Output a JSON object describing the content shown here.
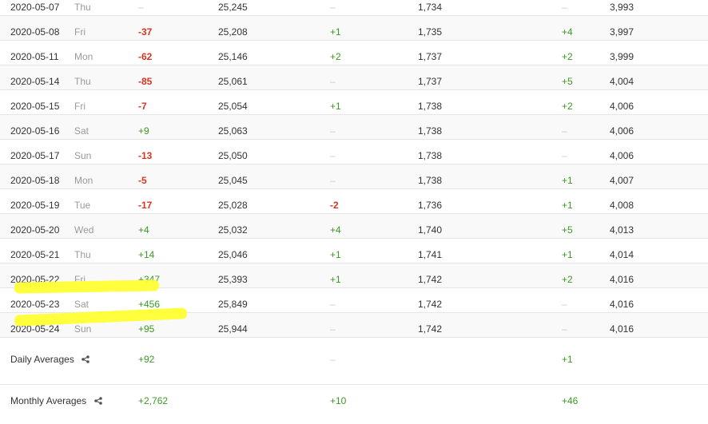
{
  "colors": {
    "negative": "#d9341f",
    "positive": "#3a9a22",
    "dash": "#c8c8c8",
    "highlight": "#ffff33"
  },
  "rows": [
    {
      "date": "2020-05-07",
      "day": "Thu",
      "d1": "–",
      "subs": "25,245",
      "d2": "–",
      "uploads": "1,734",
      "d3": "–",
      "views": "3,993"
    },
    {
      "date": "2020-05-08",
      "day": "Fri",
      "d1": "-37",
      "subs": "25,208",
      "d2": "+1",
      "uploads": "1,735",
      "d3": "+4",
      "views": "3,997"
    },
    {
      "date": "2020-05-11",
      "day": "Mon",
      "d1": "-62",
      "subs": "25,146",
      "d2": "+2",
      "uploads": "1,737",
      "d3": "+2",
      "views": "3,999"
    },
    {
      "date": "2020-05-14",
      "day": "Thu",
      "d1": "-85",
      "subs": "25,061",
      "d2": "–",
      "uploads": "1,737",
      "d3": "+5",
      "views": "4,004"
    },
    {
      "date": "2020-05-15",
      "day": "Fri",
      "d1": "-7",
      "subs": "25,054",
      "d2": "+1",
      "uploads": "1,738",
      "d3": "+2",
      "views": "4,006"
    },
    {
      "date": "2020-05-16",
      "day": "Sat",
      "d1": "+9",
      "subs": "25,063",
      "d2": "–",
      "uploads": "1,738",
      "d3": "–",
      "views": "4,006"
    },
    {
      "date": "2020-05-17",
      "day": "Sun",
      "d1": "-13",
      "subs": "25,050",
      "d2": "–",
      "uploads": "1,738",
      "d3": "–",
      "views": "4,006"
    },
    {
      "date": "2020-05-18",
      "day": "Mon",
      "d1": "-5",
      "subs": "25,045",
      "d2": "–",
      "uploads": "1,738",
      "d3": "+1",
      "views": "4,007"
    },
    {
      "date": "2020-05-19",
      "day": "Tue",
      "d1": "-17",
      "subs": "25,028",
      "d2": "-2",
      "uploads": "1,736",
      "d3": "+1",
      "views": "4,008"
    },
    {
      "date": "2020-05-20",
      "day": "Wed",
      "d1": "+4",
      "subs": "25,032",
      "d2": "+4",
      "uploads": "1,740",
      "d3": "+5",
      "views": "4,013"
    },
    {
      "date": "2020-05-21",
      "day": "Thu",
      "d1": "+14",
      "subs": "25,046",
      "d2": "+1",
      "uploads": "1,741",
      "d3": "+1",
      "views": "4,014"
    },
    {
      "date": "2020-05-22",
      "day": "Fri",
      "d1": "+347",
      "subs": "25,393",
      "d2": "+1",
      "uploads": "1,742",
      "d3": "+2",
      "views": "4,016"
    },
    {
      "date": "2020-05-23",
      "day": "Sat",
      "d1": "+456",
      "subs": "25,849",
      "d2": "–",
      "uploads": "1,742",
      "d3": "–",
      "views": "4,016"
    },
    {
      "date": "2020-05-24",
      "day": "Sun",
      "d1": "+95",
      "subs": "25,944",
      "d2": "–",
      "uploads": "1,742",
      "d3": "–",
      "views": "4,016"
    }
  ],
  "averages": {
    "daily": {
      "label": "Daily Averages",
      "d1": "+92",
      "d2": "–",
      "d3": "+1",
      "icon": "share-icon"
    },
    "monthly": {
      "label": "Monthly Averages",
      "d1": "+2,762",
      "d2": "+10",
      "d3": "+46",
      "icon": "share-icon"
    }
  }
}
